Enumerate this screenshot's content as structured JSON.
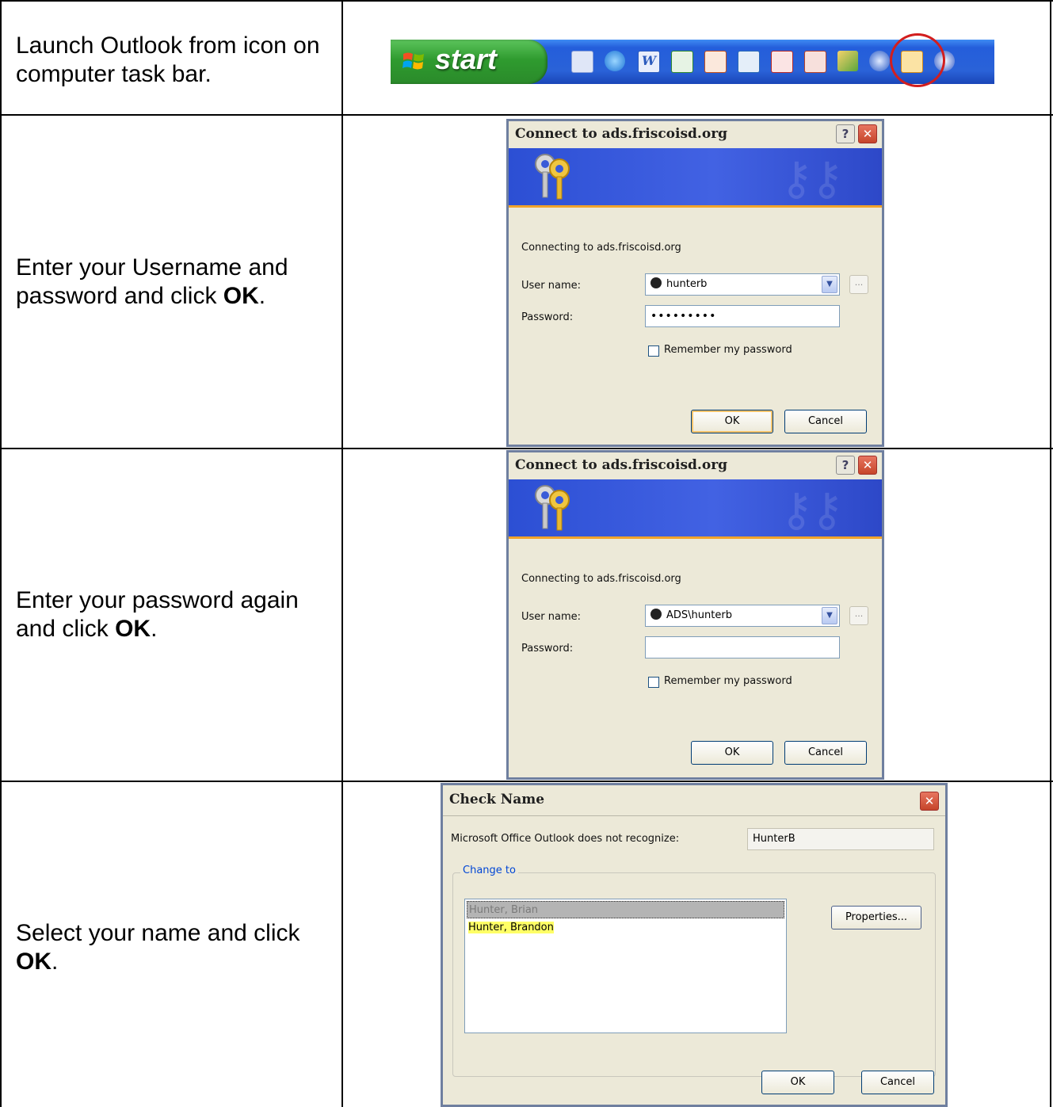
{
  "steps": [
    {
      "text": "Launch Outlook from icon on computer task bar.",
      "bold": ""
    },
    {
      "text": "Enter your Username and password and click ",
      "bold": "OK"
    },
    {
      "text": "Enter your password again and click ",
      "bold": "OK"
    },
    {
      "text": "Select your name and click ",
      "bold": "OK"
    }
  ],
  "taskbar": {
    "start_label": "start"
  },
  "connect_dialog_1": {
    "title": "Connect to ads.friscoisd.org",
    "help": "?",
    "close": "✕",
    "connecting_text": "Connecting to ads.friscoisd.org",
    "username_label": "User name:",
    "username_value": "hunterb",
    "password_label": "Password:",
    "password_value": "•••••••••",
    "remember_label": "Remember my password",
    "ok_label": "OK",
    "cancel_label": "Cancel",
    "dots": "..."
  },
  "connect_dialog_2": {
    "title": "Connect to ads.friscoisd.org",
    "help": "?",
    "close": "✕",
    "connecting_text": "Connecting to ads.friscoisd.org",
    "username_label": "User name:",
    "username_value": "ADS\\hunterb",
    "password_label": "Password:",
    "password_value": "",
    "remember_label": "Remember my password",
    "ok_label": "OK",
    "cancel_label": "Cancel",
    "dots": "..."
  },
  "check_name_dialog": {
    "title": "Check Name",
    "close": "✕",
    "not_recognize_label": "Microsoft Office Outlook does not recognize:",
    "not_recognize_value": "HunterB",
    "change_to_label": "Change to",
    "list_items": [
      "Hunter, Brian",
      "Hunter, Brandon"
    ],
    "properties_label": "Properties...",
    "ok_label": "OK",
    "cancel_label": "Cancel"
  },
  "colors": {
    "accent_ring": "#d21e1e",
    "highlight": "#ffff66"
  }
}
